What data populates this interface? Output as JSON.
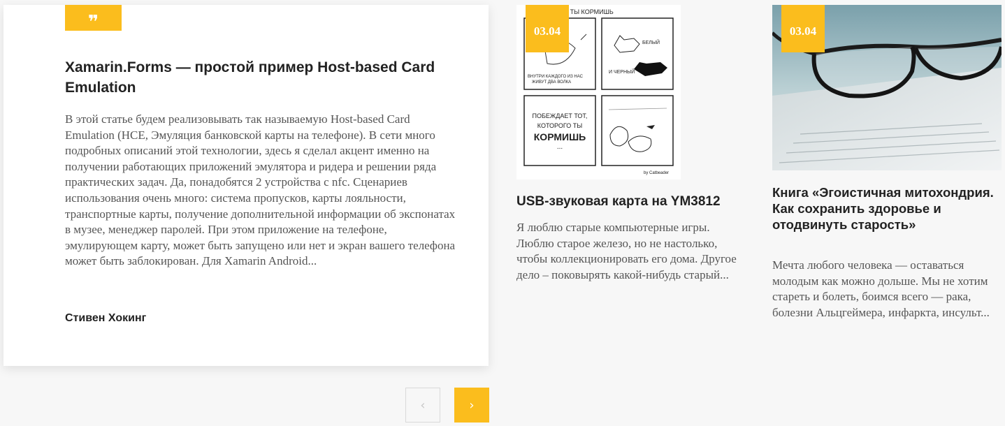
{
  "featured": {
    "quote_icon": "quote-icon",
    "title": "Xamarin.Forms — простой пример Host-based Card Emulation",
    "text": "В этой статье будем реализовывать так называемую Host-based Card Emulation (HCE, Эмуляция банковской карты на телефоне). В сети много подробных описаний этой технологии, здесь я сделал акцент именно на получении работающих приложений эмулятора и ридера и решении ряда практических задач. Да, понадобятся 2 устройства с nfc. Сценариев использования очень много: система пропусков, карты лояльности, транспортные карты, получение дополнительной информации об экспонатах в музее, менеджер паролей. При этом приложение на телефоне, эмулирующем карту, может быть запущено или нет и экран вашего телефона может быть заблокирован. Для Xamarin Android...",
    "author": "Стивен Хокинг"
  },
  "pagination": {
    "prev": "‹",
    "next": "›"
  },
  "cards": [
    {
      "date": "03.04",
      "title": "USB-звуковая карта на YM3812",
      "text": "Я люблю старые компьютерные игры. Люблю старое железо, но не настолько, чтобы коллекционировать его дома. Другое дело – поковырять какой-нибудь старый...",
      "comic": {
        "header": "ТО ТЫ КОРМИШЬ",
        "panel1": "ВНУТРИ КАЖДОГО ИЗ НАС ЖИВУТ ДВА ВОЛКА",
        "white": "БЕЛЫЙ",
        "and_black": "И ЧЕРНЫЙ",
        "panel3_a": "ПОБЕЖДАЕТ ТОТ,",
        "panel3_b": "КОТОРОГО ТЫ",
        "panel3_c": "КОРМИШЬ",
        "panel3_dots": "...",
        "signature": "by Catbeader"
      }
    },
    {
      "date": "03.04",
      "title": "Книга «Эгоистичная митохондрия. Как сохранить здоровье и отодвинуть старость»",
      "text": "Мечта любого человека — оставаться молодым как можно дольше. Мы не хотим стареть и болеть, боимся всего — рака, болезни Альцгеймера, инфаркта, инсульт..."
    }
  ],
  "colors": {
    "accent": "#fbbd1d",
    "background": "#f7f7f7"
  }
}
